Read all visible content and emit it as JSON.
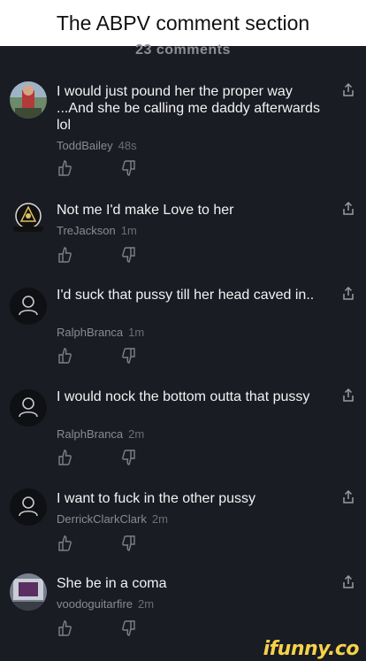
{
  "caption": "The ABPV comment section",
  "comment_count_label": "23 comments",
  "comments": [
    {
      "text": "I would just pound her the proper way ...And she be calling me daddy afterwards lol",
      "user": "ToddBailey",
      "time": "48s",
      "avatar": "photo-avatar"
    },
    {
      "text": "Not me I'd make Love to her",
      "user": "TreJackson",
      "time": "1m",
      "avatar": "logo-avatar"
    },
    {
      "text": "I'd suck that pussy till her head caved in..",
      "user": "RalphBranca",
      "time": "1m",
      "avatar": "default-avatar"
    },
    {
      "text": "I would nock the bottom outta that pussy",
      "user": "RalphBranca",
      "time": "2m",
      "avatar": "default-avatar"
    },
    {
      "text": "I want to fuck in the other pussy",
      "user": "DerrickClarkClark",
      "time": "2m",
      "avatar": "default-avatar"
    },
    {
      "text": "She be in a coma",
      "user": "voodoguitarfire",
      "time": "2m",
      "avatar": "photo-avatar"
    }
  ],
  "watermark": "ifunny.co",
  "colors": {
    "background": "#1a1c23",
    "text": "#f2f2f4",
    "meta": "#8a8b91",
    "watermark": "#f6d24a"
  }
}
